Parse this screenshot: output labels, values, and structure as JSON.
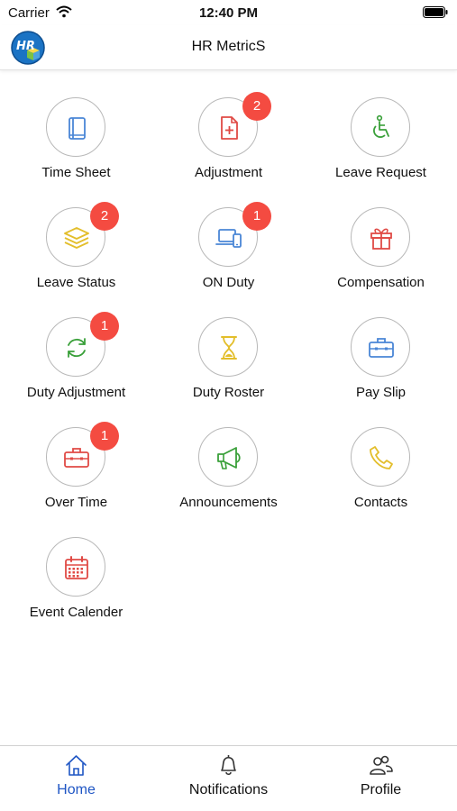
{
  "status_bar": {
    "carrier": "Carrier",
    "time": "12:40 PM"
  },
  "header": {
    "title": "HR MetricS",
    "logo_text": "HR"
  },
  "colors": {
    "badge": "#f44b41",
    "active_tab": "#1f56c4",
    "circle_border": "#b8b8b8"
  },
  "menu": {
    "items": [
      {
        "label": "Time Sheet",
        "badge": "",
        "icon": "book-icon"
      },
      {
        "label": "Adjustment",
        "badge": "2",
        "icon": "document-plus-icon"
      },
      {
        "label": "Leave Request",
        "badge": "",
        "icon": "wheelchair-icon"
      },
      {
        "label": "Leave Status",
        "badge": "2",
        "icon": "layers-icon"
      },
      {
        "label": "ON Duty",
        "badge": "1",
        "icon": "laptop-phone-icon"
      },
      {
        "label": "Compensation",
        "badge": "",
        "icon": "gift-icon"
      },
      {
        "label": "Duty Adjustment",
        "badge": "1",
        "icon": "refresh-icon"
      },
      {
        "label": "Duty Roster",
        "badge": "",
        "icon": "hourglass-icon"
      },
      {
        "label": "Pay Slip",
        "badge": "",
        "icon": "briefcase-icon"
      },
      {
        "label": "Over Time",
        "badge": "1",
        "icon": "briefcase-icon"
      },
      {
        "label": "Announcements",
        "badge": "",
        "icon": "megaphone-icon"
      },
      {
        "label": "Contacts",
        "badge": "",
        "icon": "phone-icon"
      },
      {
        "label": "Event Calender",
        "badge": "",
        "icon": "calendar-icon"
      }
    ]
  },
  "tabs": [
    {
      "label": "Home",
      "icon": "home-icon",
      "active": true
    },
    {
      "label": "Notifications",
      "icon": "bell-icon",
      "active": false
    },
    {
      "label": "Profile",
      "icon": "people-icon",
      "active": false
    }
  ]
}
